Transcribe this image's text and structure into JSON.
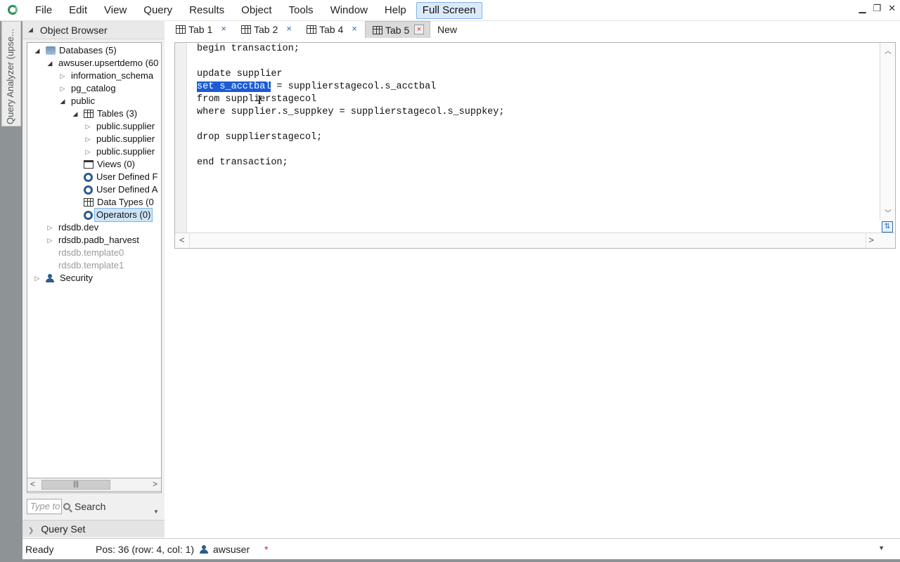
{
  "menu": {
    "items": [
      "File",
      "Edit",
      "View",
      "Query",
      "Results",
      "Object",
      "Tools",
      "Window",
      "Help"
    ],
    "fullscreen_label": "Full Screen"
  },
  "window_controls": {
    "minimize": "▁",
    "restore": "❐",
    "close": "✕"
  },
  "side_tab": {
    "label": "Query Analyzer (upse..."
  },
  "object_browser": {
    "title": "Object Browser",
    "tree": [
      {
        "label": "Databases (5)",
        "icon": "database-icon",
        "arrow": "open"
      },
      {
        "label": "awsuser.upsertdemo (60",
        "icon": "",
        "arrow": "open"
      },
      {
        "label": "information_schema",
        "icon": "",
        "arrow": "closed"
      },
      {
        "label": "pg_catalog",
        "icon": "",
        "arrow": "closed"
      },
      {
        "label": "public",
        "icon": "",
        "arrow": "open"
      },
      {
        "label": "Tables (3)",
        "icon": "table-icon",
        "arrow": "open"
      },
      {
        "label": "public.supplier",
        "icon": "",
        "arrow": "closed"
      },
      {
        "label": "public.supplier",
        "icon": "",
        "arrow": "closed"
      },
      {
        "label": "public.supplier",
        "icon": "",
        "arrow": "closed"
      },
      {
        "label": "Views (0)",
        "icon": "view-icon",
        "arrow": "none"
      },
      {
        "label": "User Defined F",
        "icon": "gear-icon",
        "arrow": "none"
      },
      {
        "label": "User Defined A",
        "icon": "gear-icon",
        "arrow": "none"
      },
      {
        "label": "Data Types (0",
        "icon": "table-icon",
        "arrow": "none"
      },
      {
        "label": "Operators (0)",
        "icon": "gear-icon",
        "arrow": "none"
      },
      {
        "label": "rdsdb.dev",
        "icon": "",
        "arrow": "closed"
      },
      {
        "label": "rdsdb.padb_harvest",
        "icon": "",
        "arrow": "closed"
      },
      {
        "label": "rdsdb.template0",
        "icon": "",
        "arrow": "none"
      },
      {
        "label": "rdsdb.template1",
        "icon": "",
        "arrow": "none"
      },
      {
        "label": "Security",
        "icon": "user-icon",
        "arrow": "closed"
      }
    ],
    "filter_placeholder": "Type to",
    "search_label": "Search"
  },
  "query_set": {
    "label": "Query Set"
  },
  "tabs": [
    {
      "label": "Tab 1",
      "close": "×"
    },
    {
      "label": "Tab 2",
      "close": "×"
    },
    {
      "label": "Tab 4",
      "close": "×"
    },
    {
      "label": "Tab 5",
      "close": "×"
    }
  ],
  "new_tab_label": "New",
  "editor": {
    "lines": [
      "begin transaction;",
      "",
      "update supplier",
      "set s_acctbal = supplierstagecol.s_acctbal",
      "from supplierstagecol",
      "where supplier.s_suppkey = supplierstagecol.s_suppkey;",
      "",
      "drop supplierstagecol;",
      "",
      "end transaction;"
    ],
    "selection": "set s_acctbal",
    "cursor_glyph": "I"
  },
  "status": {
    "ready": "Ready",
    "position": "Pos: 36 (row: 4, col: 1)",
    "user": "awsuser",
    "modified": "*"
  },
  "colors": {
    "accent": "#1b5bd6",
    "selection_bg": "#cde4f7",
    "fullscreen_bg": "#dbeafa"
  }
}
